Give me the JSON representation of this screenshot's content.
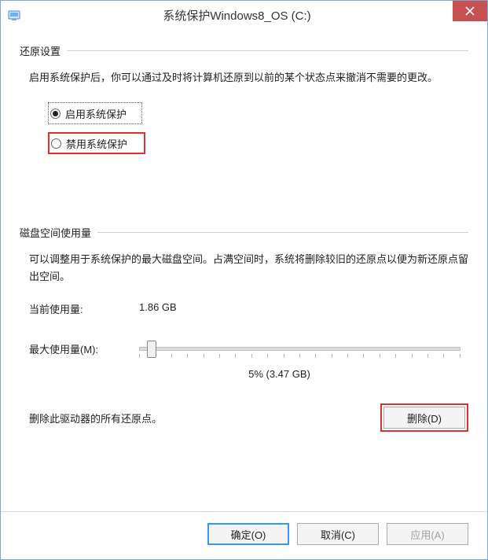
{
  "window": {
    "title": "系统保护Windows8_OS (C:)"
  },
  "restore_section": {
    "header": "还原设置",
    "description": "启用系统保护后，你可以通过及时将计算机还原到以前的某个状态点来撤消不需要的更改。",
    "options": {
      "enable": "启用系统保护",
      "disable": "禁用系统保护"
    }
  },
  "disk_section": {
    "header": "磁盘空间使用量",
    "description": "可以调整用于系统保护的最大磁盘空间。占满空间时，系统将删除较旧的还原点以便为新还原点留出空间。",
    "current_label": "当前使用量:",
    "current_value": "1.86 GB",
    "max_label": "最大使用量(M):",
    "slider_value_text": "5% (3.47 GB)",
    "delete_desc": "删除此驱动器的所有还原点。",
    "delete_button": "删除(D)"
  },
  "footer": {
    "ok": "确定(O)",
    "cancel": "取消(C)",
    "apply": "应用(A)"
  }
}
